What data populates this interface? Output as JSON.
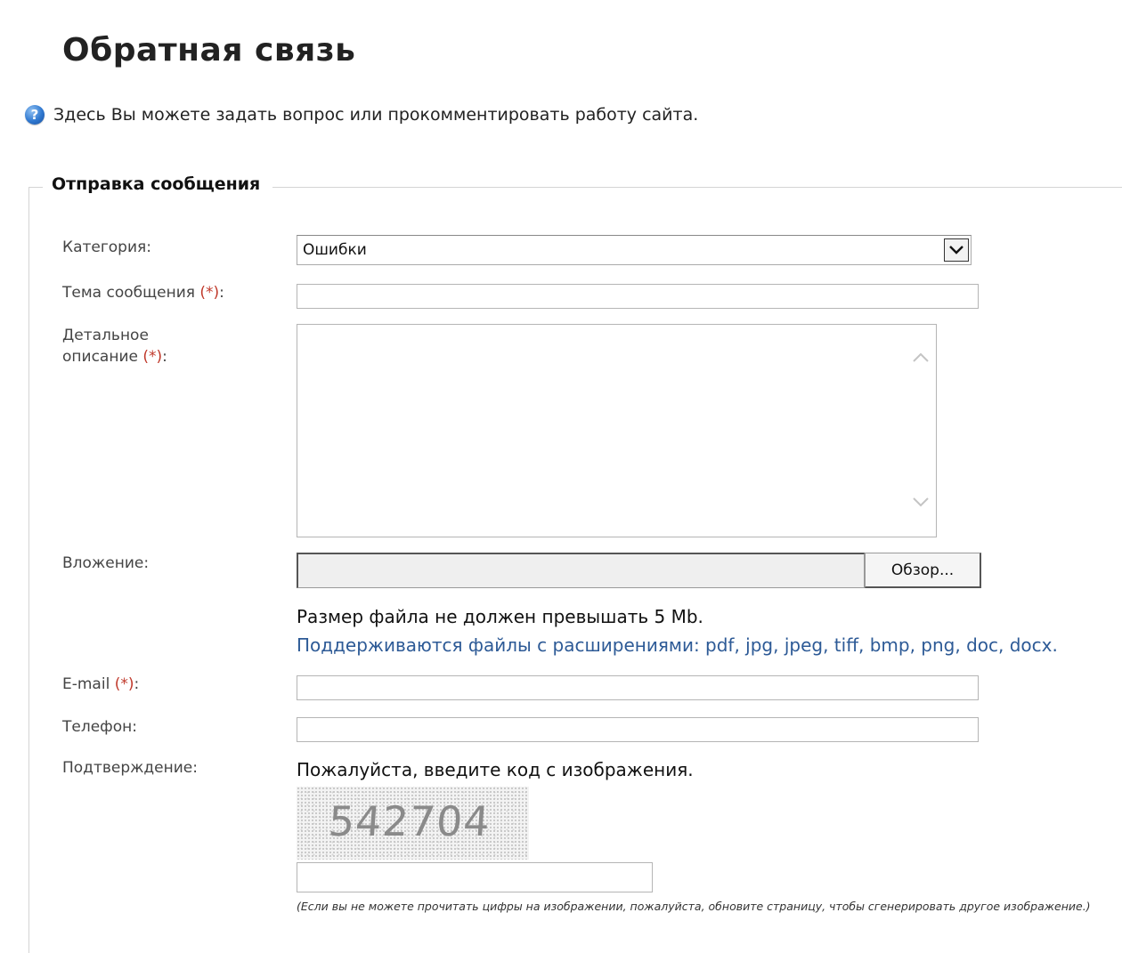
{
  "page_title": "Обратная связь",
  "intro": {
    "icon": "question-help-icon",
    "text": "Здесь Вы можете задать вопрос или прокомментировать работу сайта."
  },
  "fieldset": {
    "legend": "Отправка сообщения"
  },
  "form": {
    "required_mark": "(*)",
    "category": {
      "label": "Категория:",
      "value": "Ошибки"
    },
    "subject": {
      "label": "Тема сообщения",
      "suffix": ":",
      "value": ""
    },
    "description": {
      "label_line1": "Детальное",
      "label_line2": "описание",
      "suffix": ":",
      "value": ""
    },
    "attachment": {
      "label": "Вложение:",
      "browse_label": "Обзор...",
      "size_hint": "Размер файла не должен превышать 5 Mb.",
      "ext_hint": "Поддерживаются файлы с расширениями: pdf, jpg, jpeg, tiff, bmp, png, doc, docx."
    },
    "email": {
      "label": "E-mail",
      "suffix": ":",
      "value": ""
    },
    "phone": {
      "label": "Телефон:",
      "value": ""
    },
    "confirmation": {
      "label": "Подтверждение:",
      "prompt": "Пожалуйста, введите код с изображения.",
      "captcha_code": "542704",
      "value": "",
      "note": "(Если вы не можете прочитать цифры на изображении, пожалуйста, обновите страницу, чтобы сгенерировать другое изображение.)"
    }
  },
  "colors": {
    "required": "#c0392b",
    "link_hint": "#2d5a96",
    "help_icon": "#2f78d0"
  }
}
